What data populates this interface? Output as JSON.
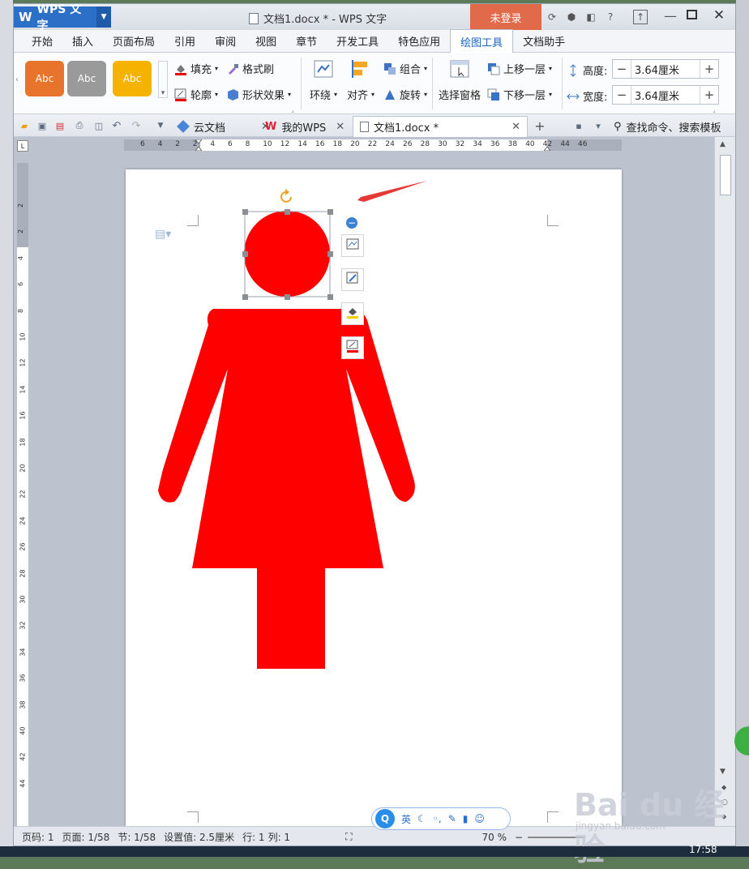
{
  "titlebar": {
    "app_name": "WPS 文字",
    "doc_title": "文档1.docx * - WPS 文字",
    "login": "未登录"
  },
  "ribbon_tabs": [
    "开始",
    "插入",
    "页面布局",
    "引用",
    "审阅",
    "视图",
    "章节",
    "开发工具",
    "特色应用",
    "绘图工具",
    "文档助手"
  ],
  "active_tab": "绘图工具",
  "ribbon": {
    "style_swatches": [
      {
        "label": "Abc",
        "color": "#e8742c"
      },
      {
        "label": "Abc",
        "color": "#9a9a9a"
      },
      {
        "label": "Abc",
        "color": "#f5b300"
      }
    ],
    "fill": "填充",
    "format_painter": "格式刷",
    "outline": "轮廓",
    "shape_effect": "形状效果",
    "wrap": "环绕",
    "align": "对齐",
    "group": "组合",
    "rotate": "旋转",
    "selection_pane": "选择窗格",
    "bring_forward": "上移一层",
    "send_backward": "下移一层",
    "height_label": "高度:",
    "height_value": "3.64厘米",
    "width_label": "宽度:",
    "width_value": "3.64厘米"
  },
  "doc_tabs": [
    {
      "label": "云文档",
      "icon": "cloud-icon"
    },
    {
      "label": "我的WPS",
      "icon": "wps-icon"
    },
    {
      "label": "文档1.docx *",
      "icon": "document-icon"
    }
  ],
  "search_command": "查找命令、搜索模板",
  "hruler_numbers": [
    "6",
    "4",
    "2",
    "2",
    "4",
    "6",
    "8",
    "10",
    "12",
    "14",
    "16",
    "18",
    "20",
    "22",
    "24",
    "26",
    "28",
    "30",
    "32",
    "34",
    "36",
    "38",
    "40",
    "42",
    "44",
    "46"
  ],
  "vruler_numbers": [
    "2",
    "2",
    "4",
    "6",
    "8",
    "10",
    "12",
    "14",
    "16",
    "18",
    "20",
    "22",
    "24",
    "26",
    "28",
    "30",
    "32",
    "34",
    "36",
    "38",
    "40",
    "42",
    "44"
  ],
  "status": {
    "page_code": "页码: 1",
    "page": "页面: 1/58",
    "section": "节: 1/58",
    "setting": "设置值: 2.5厘米",
    "row": "行: 1",
    "col": "列: 1",
    "zoom": "70 %"
  },
  "ime": {
    "lang": "英"
  },
  "clock": "17:58",
  "watermark": "Bai du 经验",
  "watermark_url": "jingyan.baidu.com",
  "figure_color": "#ff0000",
  "accent_color": "#2b6fc6"
}
